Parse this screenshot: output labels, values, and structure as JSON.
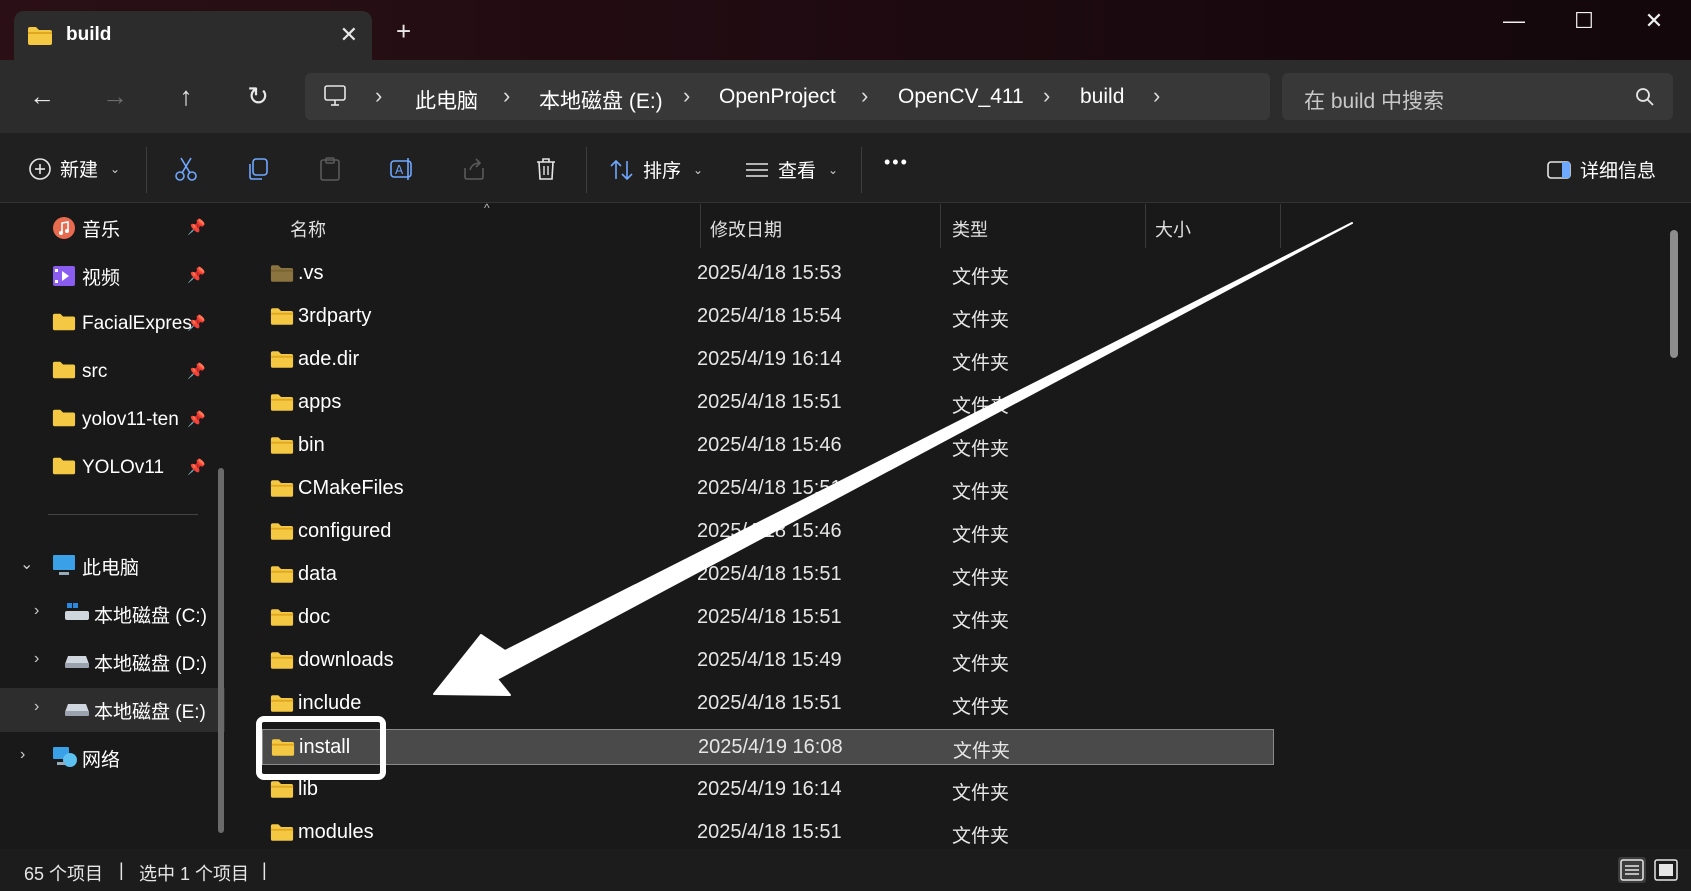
{
  "window": {
    "tab_title": "build",
    "tab_close": "✕",
    "new_tab": "+",
    "controls": {
      "minimize": "—",
      "maximize": "☐",
      "close": "✕"
    }
  },
  "nav": {
    "back": "←",
    "forward": "→",
    "up": "↑",
    "refresh": "↻",
    "breadcrumb": [
      "此电脑",
      "本地磁盘 (E:)",
      "OpenProject",
      "OpenCV_411",
      "build"
    ],
    "separator": "›",
    "search_placeholder": "在 build 中搜索"
  },
  "toolbar": {
    "new_label": "新建",
    "sort_label": "排序",
    "view_label": "查看",
    "more_label": "•••",
    "details_label": "详细信息"
  },
  "sidebar": {
    "quick_access": [
      {
        "label": "音乐",
        "icon": "music-icon"
      },
      {
        "label": "视频",
        "icon": "video-icon"
      },
      {
        "label": "FacialExpres",
        "icon": "folder-icon"
      },
      {
        "label": "src",
        "icon": "folder-icon"
      },
      {
        "label": "yolov11-ten",
        "icon": "folder-icon"
      },
      {
        "label": "YOLOv11",
        "icon": "folder-icon"
      }
    ],
    "this_pc": "此电脑",
    "drives": [
      {
        "label": "本地磁盘 (C:)"
      },
      {
        "label": "本地磁盘 (D:)"
      },
      {
        "label": "本地磁盘 (E:)",
        "selected": true
      }
    ],
    "network": "网络",
    "pin_glyph": "📌"
  },
  "columns": {
    "name": "名称",
    "date": "修改日期",
    "type": "类型",
    "size": "大小"
  },
  "files": [
    {
      "name": ".vs",
      "date": "2025/4/18 15:53",
      "type": "文件夹",
      "hidden": true
    },
    {
      "name": "3rdparty",
      "date": "2025/4/18 15:54",
      "type": "文件夹"
    },
    {
      "name": "ade.dir",
      "date": "2025/4/19 16:14",
      "type": "文件夹"
    },
    {
      "name": "apps",
      "date": "2025/4/18 15:51",
      "type": "文件夹"
    },
    {
      "name": "bin",
      "date": "2025/4/18 15:46",
      "type": "文件夹"
    },
    {
      "name": "CMakeFiles",
      "date": "2025/4/18 15:51",
      "type": "文件夹"
    },
    {
      "name": "configured",
      "date": "2025/4/18 15:46",
      "type": "文件夹"
    },
    {
      "name": "data",
      "date": "2025/4/18 15:51",
      "type": "文件夹"
    },
    {
      "name": "doc",
      "date": "2025/4/18 15:51",
      "type": "文件夹"
    },
    {
      "name": "downloads",
      "date": "2025/4/18 15:49",
      "type": "文件夹"
    },
    {
      "name": "include",
      "date": "2025/4/18 15:51",
      "type": "文件夹"
    },
    {
      "name": "install",
      "date": "2025/4/19 16:08",
      "type": "文件夹",
      "selected": true
    },
    {
      "name": "lib",
      "date": "2025/4/19 16:14",
      "type": "文件夹"
    },
    {
      "name": "modules",
      "date": "2025/4/18 15:51",
      "type": "文件夹"
    }
  ],
  "status": {
    "item_count": "65 个项目",
    "selected_count": "选中 1 个项目",
    "divider": "|"
  },
  "colors": {
    "folder": "#f4c842",
    "folder_dark": "#e0a820",
    "titlebar": "#2a1016",
    "annotation": "#ffffff"
  }
}
